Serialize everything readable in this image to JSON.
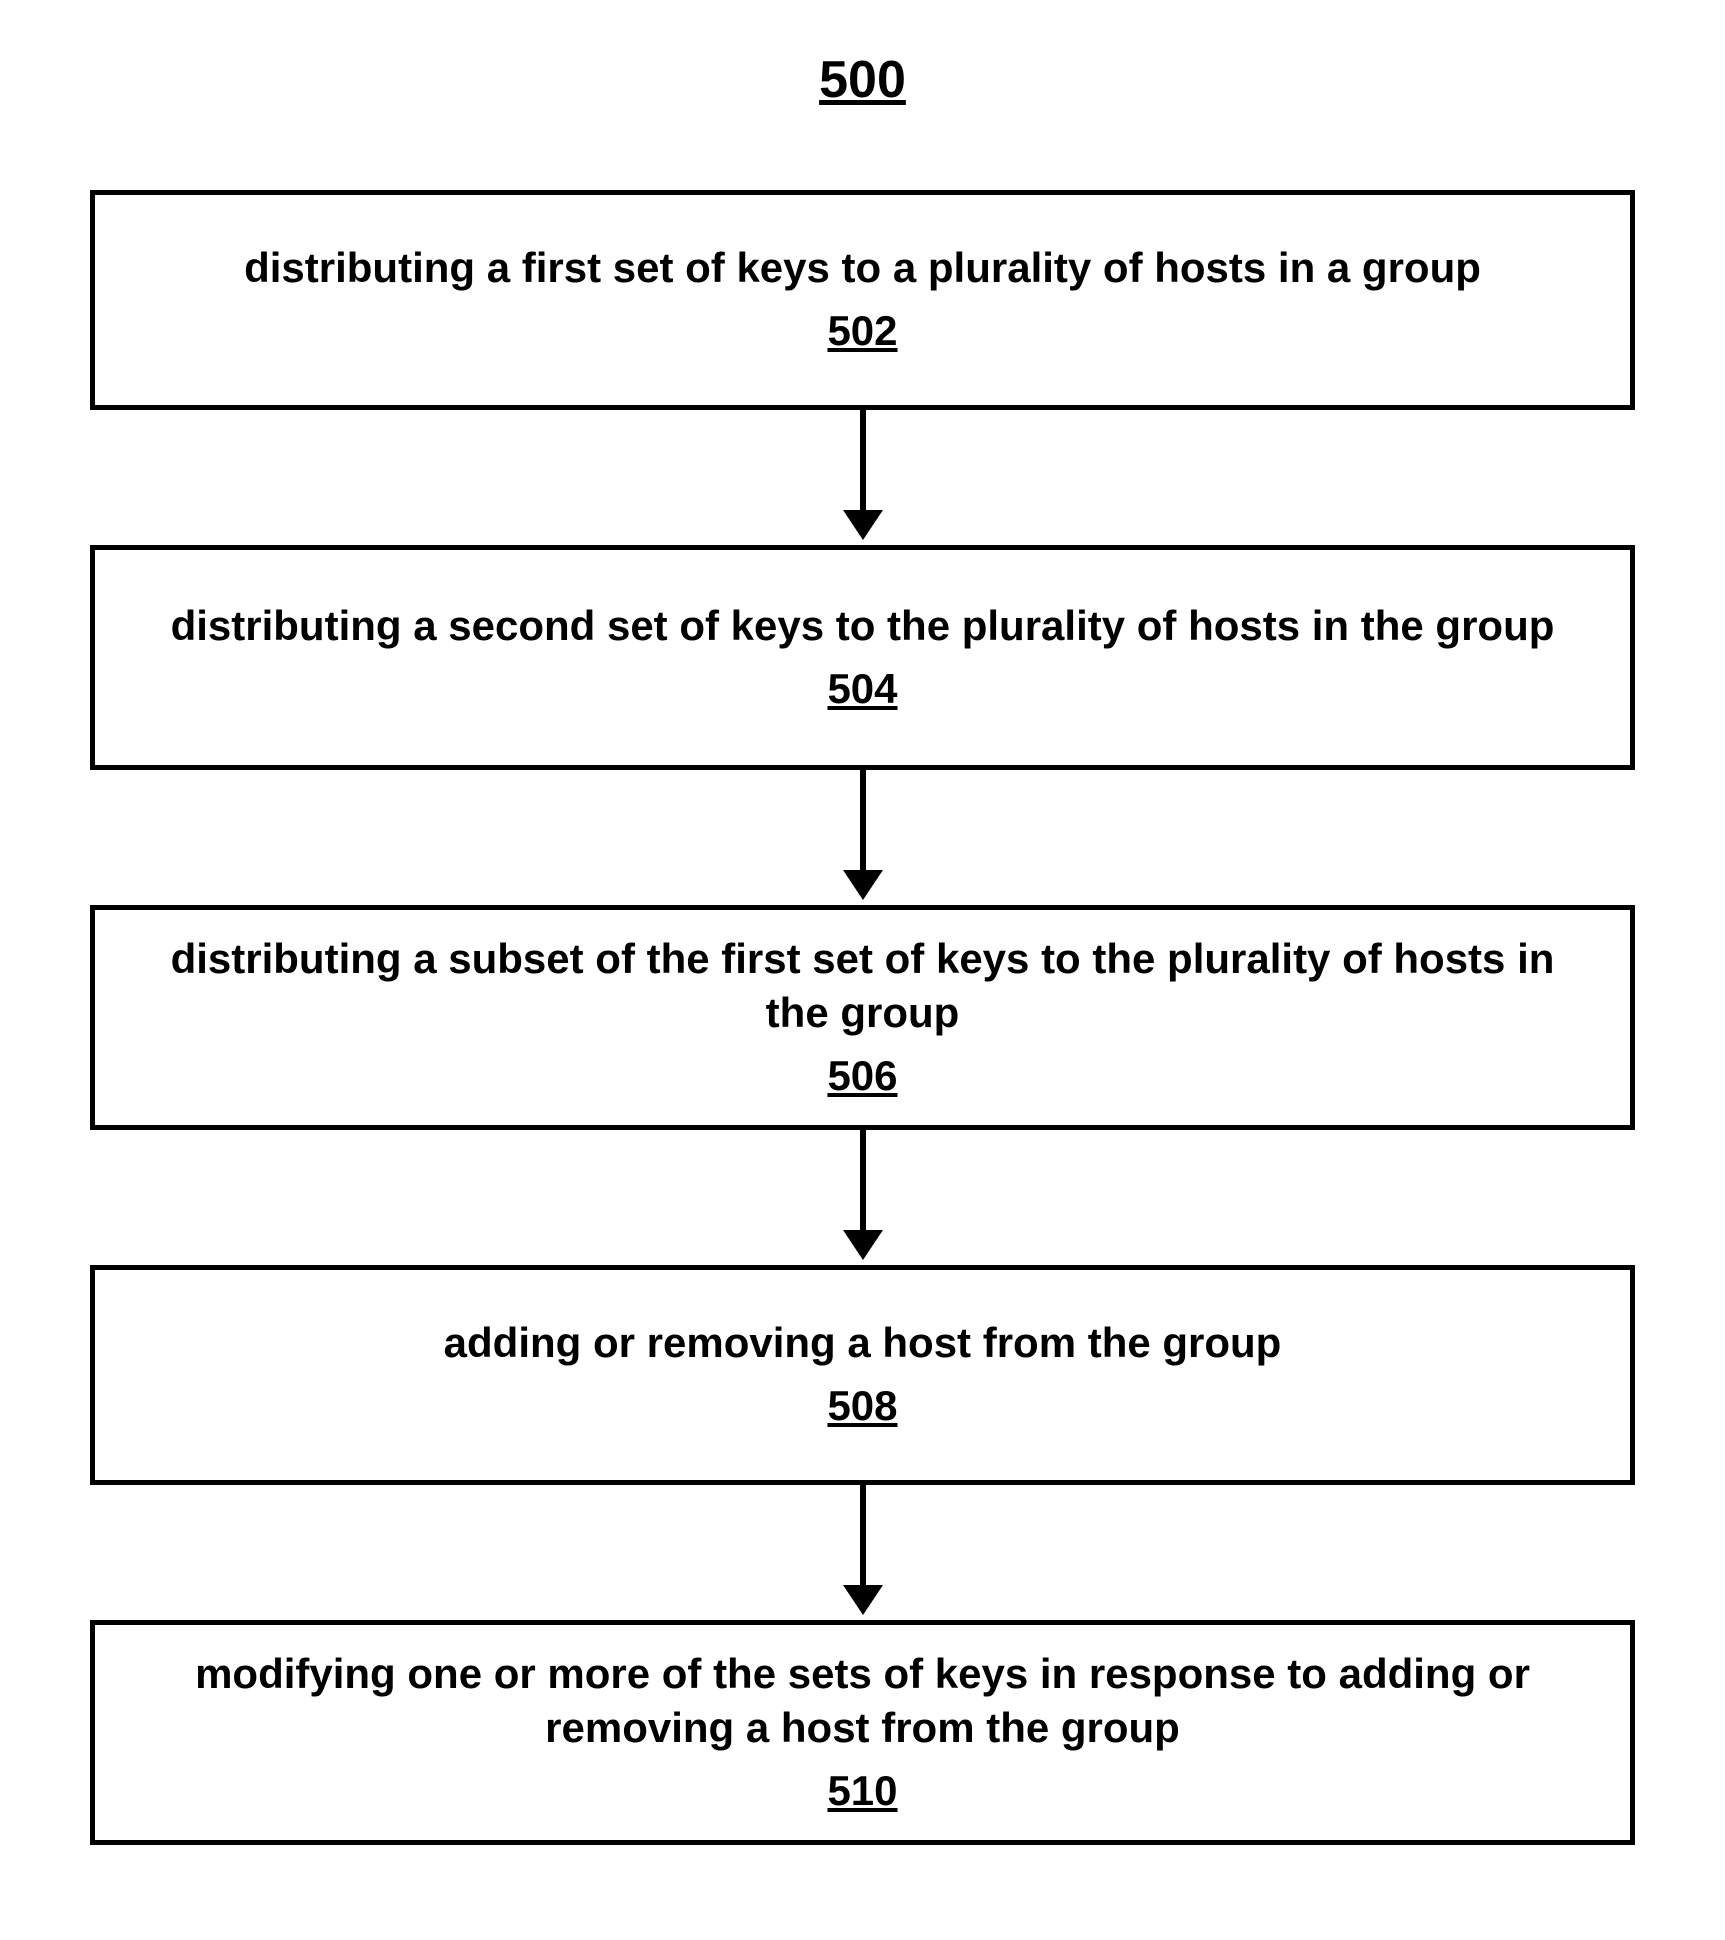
{
  "title": "500",
  "steps": [
    {
      "text": "distributing a first set of keys to a plurality of hosts in a group",
      "num": "502"
    },
    {
      "text": "distributing a second set of keys to the plurality of hosts in the group",
      "num": "504"
    },
    {
      "text": "distributing a subset of the first set of keys to the plurality of hosts in the group",
      "num": "506"
    },
    {
      "text": "adding or removing a host from the group",
      "num": "508"
    },
    {
      "text": "modifying one or more of the sets of keys in response to adding or removing a host from the group",
      "num": "510"
    }
  ]
}
